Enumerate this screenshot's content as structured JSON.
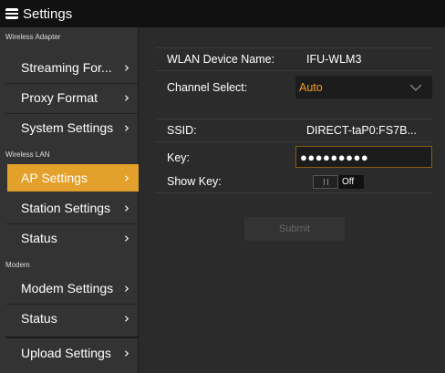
{
  "titlebar": {
    "title": "Settings"
  },
  "sidebar": {
    "sections": [
      {
        "label": "Wireless Adapter"
      },
      {
        "label": "Wireless LAN"
      },
      {
        "label": "Modem"
      }
    ],
    "items": [
      {
        "label": "Streaming For..."
      },
      {
        "label": "Proxy Format"
      },
      {
        "label": "System Settings"
      },
      {
        "label": "AP Settings",
        "active": true
      },
      {
        "label": "Station Settings"
      },
      {
        "label": "Status"
      },
      {
        "label": "Modem Settings"
      },
      {
        "label": "Status"
      },
      {
        "label": "Upload Settings"
      }
    ],
    "chevron": "›"
  },
  "form": {
    "device_name_label": "WLAN Device Name:",
    "device_name_value": "IFU-WLM3",
    "channel_label": "Channel Select:",
    "channel_value": "Auto",
    "ssid_label": "SSID:",
    "ssid_value": "DIRECT-taP0:FS7B...",
    "key_label": "Key:",
    "key_value": "●●●●●●●●●",
    "show_key_label": "Show Key:",
    "show_key_state": "Off",
    "submit_label": "Submit"
  },
  "colors": {
    "accent": "#e3a02a",
    "select_text": "#f0a020"
  }
}
